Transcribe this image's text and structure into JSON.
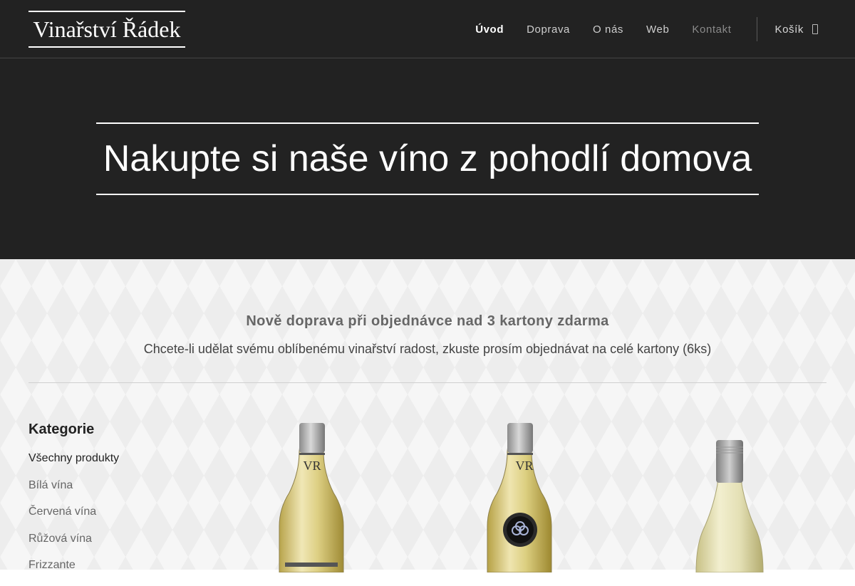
{
  "header": {
    "logo": "Vinařství Řádek",
    "nav": [
      "Úvod",
      "Doprava",
      "O nás",
      "Web",
      "Kontakt"
    ],
    "cart_label": "Košík"
  },
  "hero": {
    "title": "Nakupte si naše víno z pohodlí domova"
  },
  "notice": {
    "title": "Nově doprava při objednávce nad 3 kartony zdarma",
    "text": "Chcete-li udělat svému oblíbenému vinařství radost, zkuste prosím objednávat na celé kartony (6ks)"
  },
  "sidebar": {
    "heading": "Kategorie",
    "items": [
      "Všechny produkty",
      "Bílá vína",
      "Červená vína",
      "Růžová vína",
      "Frizzante"
    ]
  },
  "products": {
    "labels": [
      "VR",
      "VR"
    ]
  }
}
